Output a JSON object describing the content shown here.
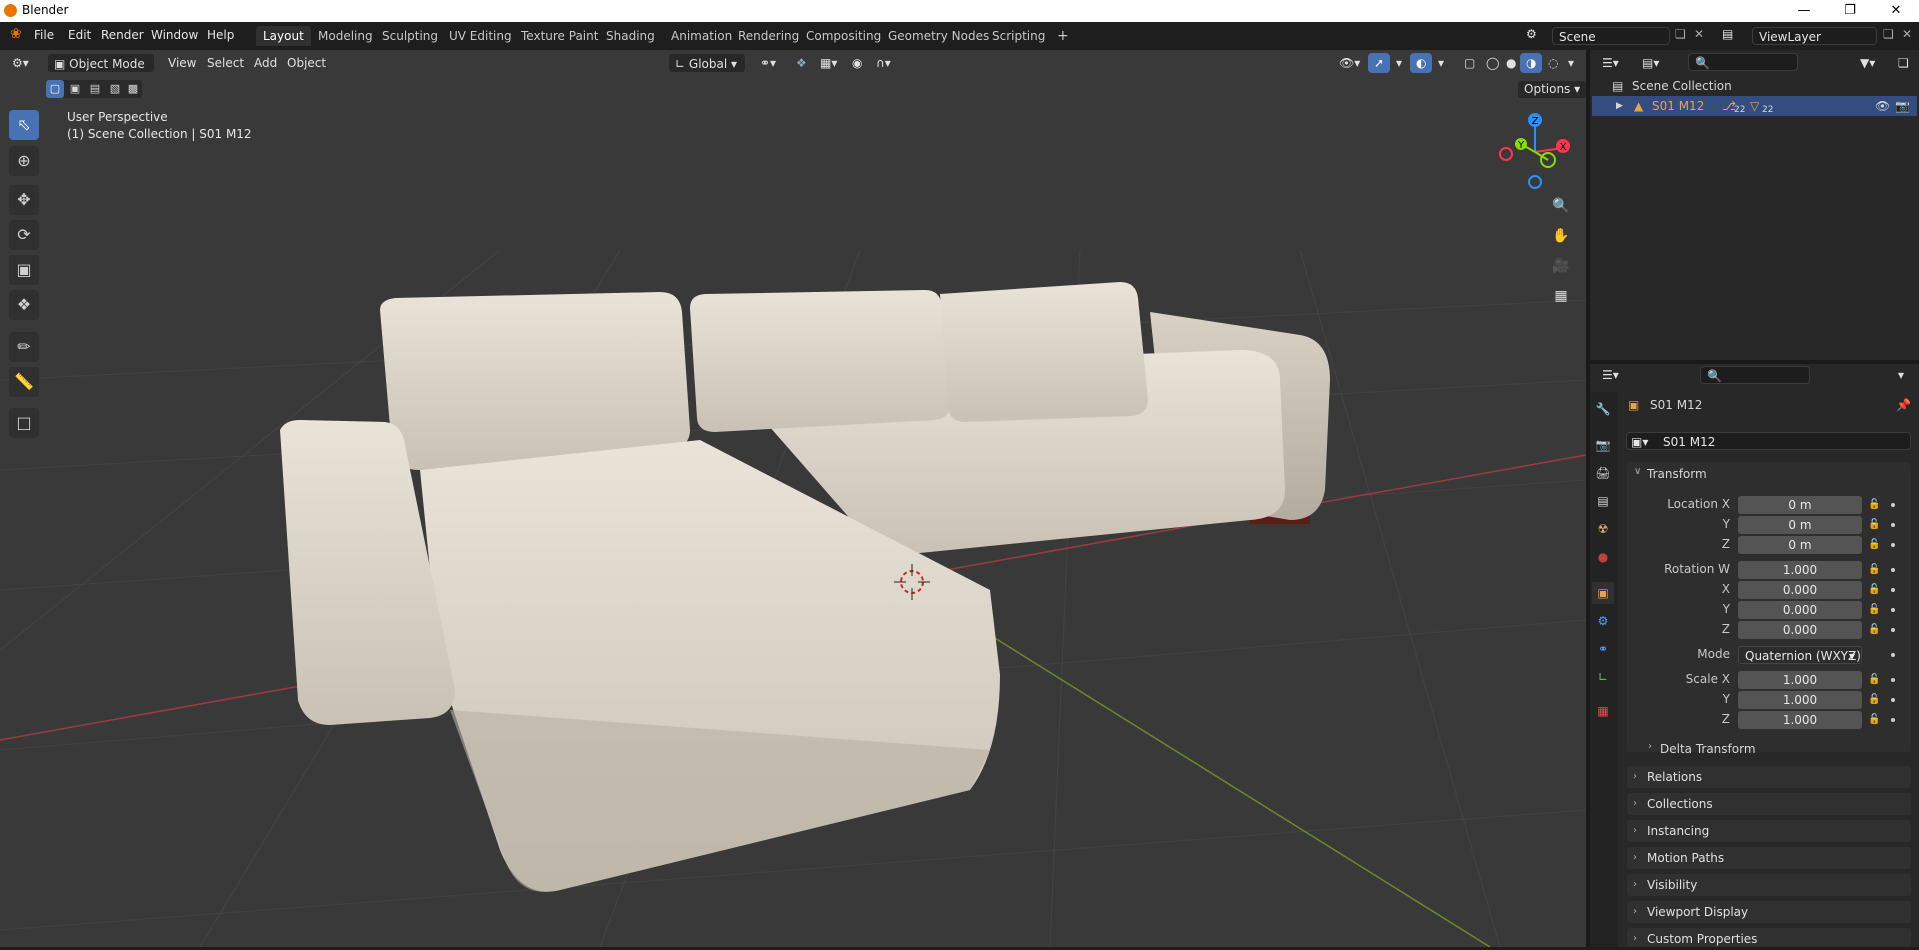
{
  "window": {
    "title": "Blender"
  },
  "menu": [
    "File",
    "Edit",
    "Render",
    "Window",
    "Help"
  ],
  "workspaces": [
    "Layout",
    "Modeling",
    "Sculpting",
    "UV Editing",
    "Texture Paint",
    "Shading",
    "Animation",
    "Rendering",
    "Compositing",
    "Geometry Nodes",
    "Scripting"
  ],
  "scene": {
    "name": "Scene",
    "view_layer": "ViewLayer"
  },
  "viewport_header": {
    "mode": "Object Mode",
    "view": "View",
    "select": "Select",
    "add": "Add",
    "object": "Object",
    "orientation": "Global",
    "options": "Options"
  },
  "viewport_info": {
    "perspective": "User Perspective",
    "collection": "(1) Scene Collection | S01 M12"
  },
  "gizmo": {
    "x": "X",
    "y": "Y",
    "z": "Z"
  },
  "outliner": {
    "root": "Scene Collection",
    "items": [
      {
        "name": "S01 M12",
        "mod_count": "22",
        "mesh_count": "22"
      }
    ]
  },
  "properties": {
    "object_name": "S01 M12",
    "data_name": "S01 M12",
    "transform_title": "Transform",
    "location": {
      "label_x": "Location X",
      "label_y": "Y",
      "label_z": "Z",
      "x": "0 m",
      "y": "0 m",
      "z": "0 m"
    },
    "rotation": {
      "label_w": "Rotation W",
      "label_x": "X",
      "label_y": "Y",
      "label_z": "Z",
      "w": "1.000",
      "x": "0.000",
      "y": "0.000",
      "z": "0.000"
    },
    "mode": {
      "label": "Mode",
      "value": "Quaternion (WXYZ)"
    },
    "scale": {
      "label_x": "Scale X",
      "label_y": "Y",
      "label_z": "Z",
      "x": "1.000",
      "y": "1.000",
      "z": "1.000"
    },
    "delta": "Delta Transform",
    "panels": [
      "Relations",
      "Collections",
      "Instancing",
      "Motion Paths",
      "Visibility",
      "Viewport Display",
      "Custom Properties"
    ]
  },
  "colors": {
    "accent": "#4772b3",
    "selection": "#334d80",
    "object_orange": "#e8a24a",
    "axis_x": "#ff3352",
    "axis_y": "#8bdc00",
    "axis_z": "#2890ff"
  }
}
